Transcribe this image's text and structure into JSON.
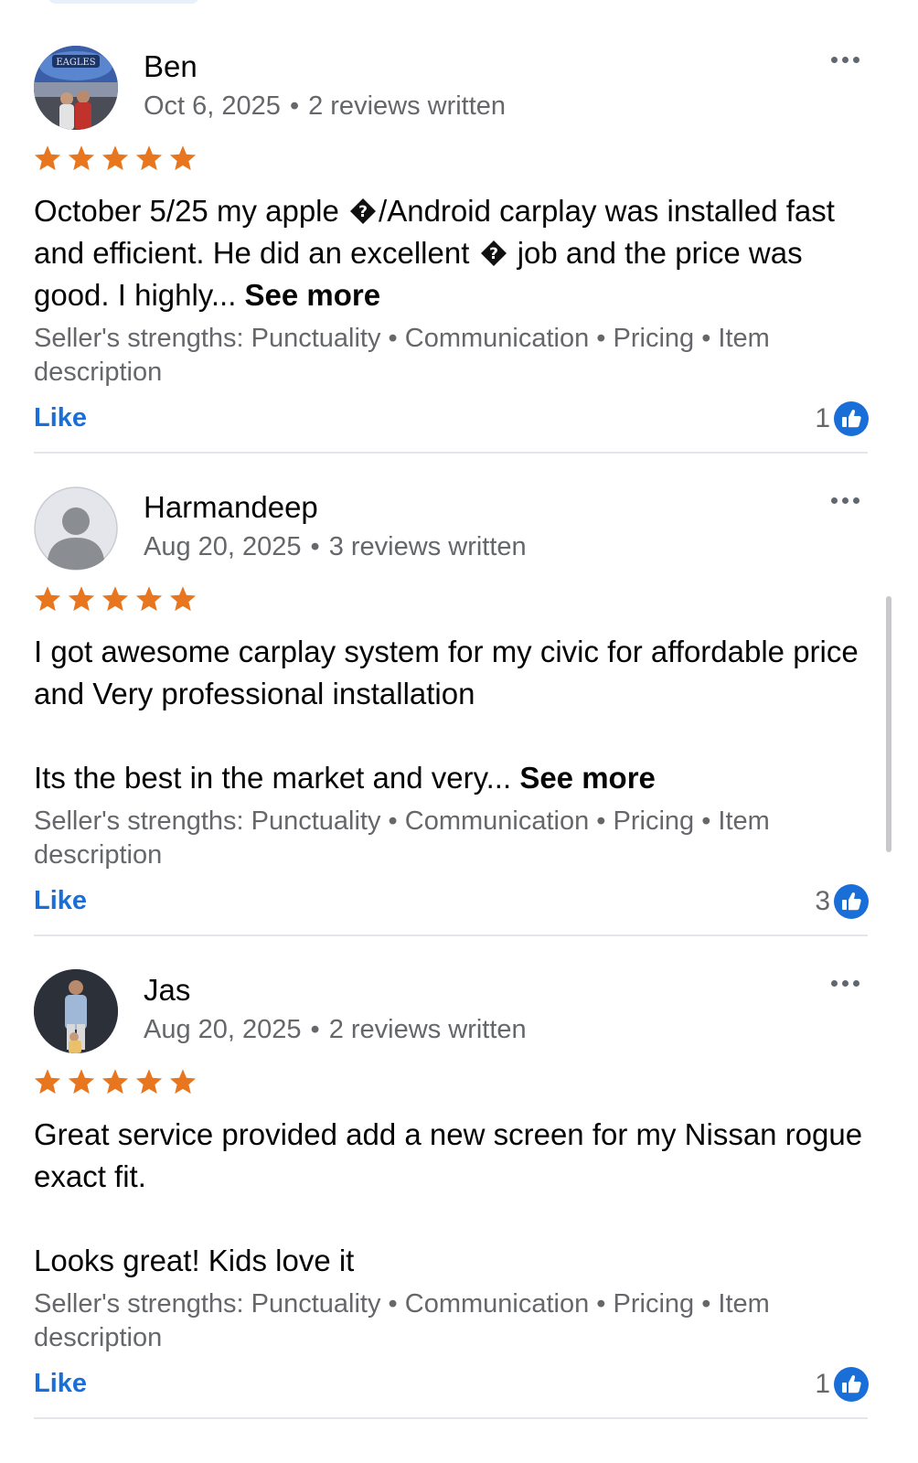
{
  "reviews": [
    {
      "name": "Ben",
      "date": "Oct 6, 2025",
      "reviews_written": "2 reviews written",
      "rating": 5,
      "body_parts": [
        "October 5/25 my apple ",
        "/Android  carplay was installed fast and  efficient.  He did an excellent ",
        " job and the price was good. I highly... "
      ],
      "see_more": "See more",
      "strengths": "Seller's strengths: Punctuality • Communication • Pricing • Item description",
      "like_label": "Like",
      "like_count": "1"
    },
    {
      "name": "Harmandeep",
      "date": "Aug 20, 2025",
      "reviews_written": "3 reviews written",
      "rating": 5,
      "body_p1": "I got awesome carplay system for my civic for affordable price and Very professional installation",
      "body_p2": "Its the best in the market and very... ",
      "see_more": "See more",
      "strengths": "Seller's strengths: Punctuality • Communication • Pricing • Item description",
      "like_label": "Like",
      "like_count": "3"
    },
    {
      "name": "Jas",
      "date": "Aug 20, 2025",
      "reviews_written": "2 reviews written",
      "rating": 5,
      "body_p1": "Great service provided add a new screen for my Nissan rogue exact fit.",
      "body_p2": "Looks great! Kids love it",
      "strengths": "Seller's strengths: Punctuality • Communication • Pricing • Item description",
      "like_label": "Like",
      "like_count": "1"
    }
  ],
  "colors": {
    "star": "#e8761e",
    "like_blue": "#1a6ed8",
    "secondary_text": "#65676b",
    "divider": "#e4e6eb"
  },
  "icons": {
    "star": "star-icon",
    "more": "more-options-icon",
    "thumbs_up": "thumbs-up-icon",
    "replacement_char": "replacement-character-glyph"
  }
}
